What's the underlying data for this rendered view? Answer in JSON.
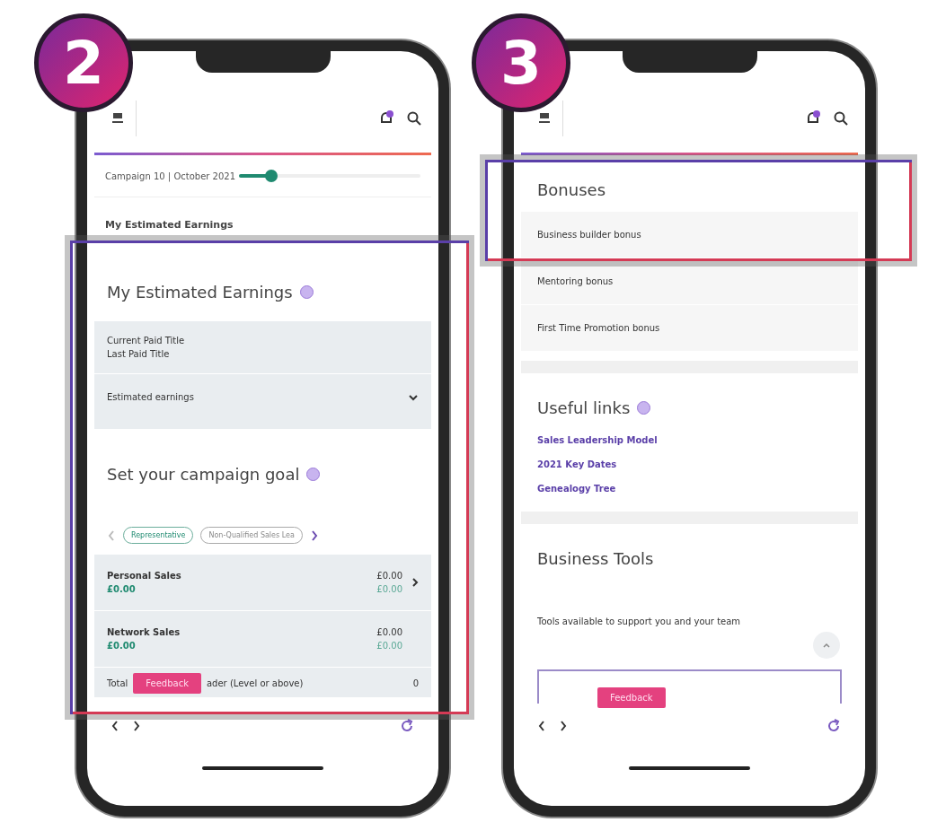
{
  "earnings_screen": {
    "step_badge": "2",
    "campaign": {
      "label": "Campaign 10 | October 2021",
      "level": 0.18
    },
    "tabs": [
      {
        "label": "My Estimated Earnings",
        "selected": true
      }
    ],
    "earnings": {
      "title": "My Estimated Earnings",
      "lines": [
        "Current Paid Title",
        "Last Paid Title"
      ],
      "dropdown": "Estimated earnings",
      "expanded": false
    },
    "goal": {
      "title": "Set your campaign goal",
      "chips": [
        {
          "label": "Representative",
          "selected": true
        },
        {
          "label": "Non-Qualified Sales Lea",
          "selected": false
        }
      ],
      "rows": [
        {
          "label": "Personal Sales",
          "value": "£0.00",
          "target": "£0.00",
          "target_sub": "£0.00",
          "arrow": true
        },
        {
          "label": "Network Sales",
          "value": "£0.00",
          "target": "£0.00",
          "target_sub": "£0.00",
          "arrow": false
        }
      ],
      "total": {
        "start": "Total",
        "end": "ader (Level or above)",
        "value": "0"
      }
    },
    "feedback": "Feedback"
  },
  "bonuses_screen": {
    "step_badge": "3",
    "bonuses": {
      "title": "Bonuses",
      "items": [
        "Business builder bonus",
        "Mentoring bonus",
        "First Time Promotion bonus"
      ]
    },
    "links": {
      "title": "Useful links",
      "items": [
        "Sales Leadership Model",
        "2021 Key Dates",
        "Genealogy Tree"
      ]
    },
    "tools": {
      "title": "Business Tools",
      "text": "Tools available to support you and your team"
    },
    "feedback": "Feedback"
  }
}
